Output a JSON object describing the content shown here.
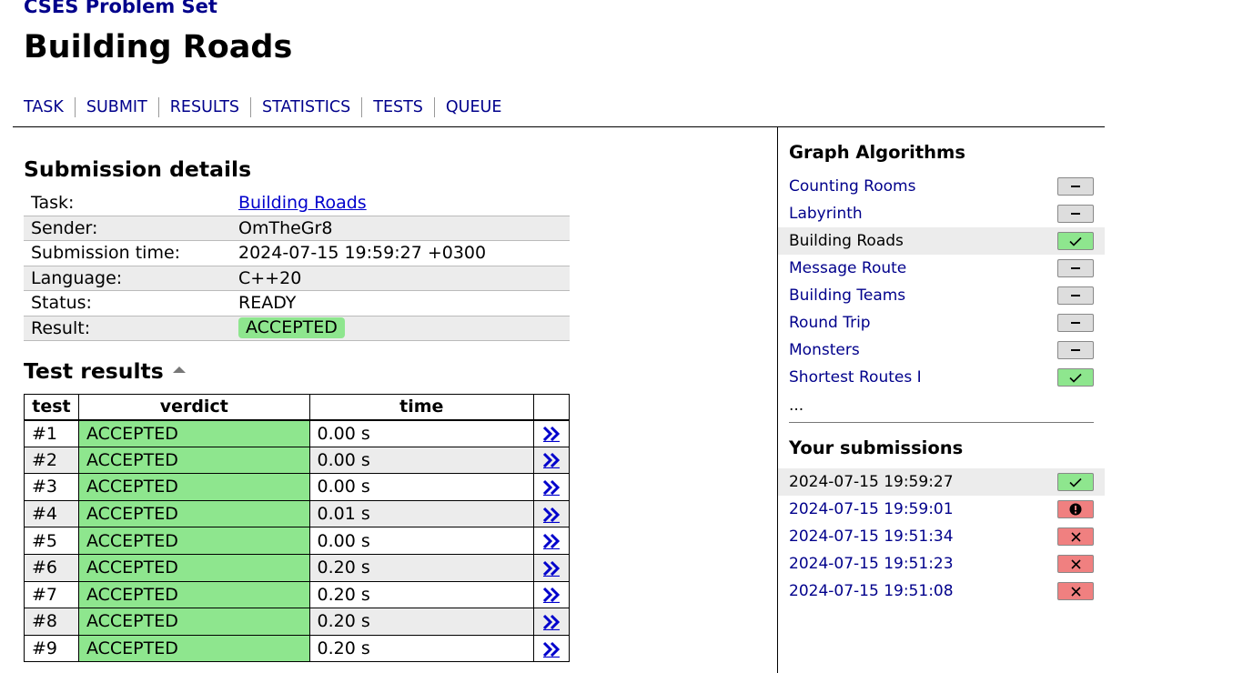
{
  "header": {
    "site_title": "CSES Problem Set",
    "page_title": "Building Roads"
  },
  "tabs": [
    "TASK",
    "SUBMIT",
    "RESULTS",
    "STATISTICS",
    "TESTS",
    "QUEUE"
  ],
  "details": {
    "heading": "Submission details",
    "rows": [
      {
        "label": "Task:",
        "value": "Building Roads"
      },
      {
        "label": "Sender:",
        "value": "OmTheGr8"
      },
      {
        "label": "Submission time:",
        "value": "2024-07-15 19:59:27 +0300"
      },
      {
        "label": "Language:",
        "value": "C++20"
      },
      {
        "label": "Status:",
        "value": "READY"
      },
      {
        "label": "Result:",
        "value": "ACCEPTED"
      }
    ]
  },
  "tests": {
    "heading": "Test results",
    "columns": [
      "test",
      "verdict",
      "time"
    ],
    "rows": [
      {
        "test": "#1",
        "verdict": "ACCEPTED",
        "time": "0.00 s"
      },
      {
        "test": "#2",
        "verdict": "ACCEPTED",
        "time": "0.00 s"
      },
      {
        "test": "#3",
        "verdict": "ACCEPTED",
        "time": "0.00 s"
      },
      {
        "test": "#4",
        "verdict": "ACCEPTED",
        "time": "0.01 s"
      },
      {
        "test": "#5",
        "verdict": "ACCEPTED",
        "time": "0.00 s"
      },
      {
        "test": "#6",
        "verdict": "ACCEPTED",
        "time": "0.20 s"
      },
      {
        "test": "#7",
        "verdict": "ACCEPTED",
        "time": "0.20 s"
      },
      {
        "test": "#8",
        "verdict": "ACCEPTED",
        "time": "0.20 s"
      },
      {
        "test": "#9",
        "verdict": "ACCEPTED",
        "time": "0.20 s"
      }
    ]
  },
  "sidebar": {
    "category": "Graph Algorithms",
    "problems": [
      {
        "name": "Counting Rooms",
        "status": "dash",
        "current": false
      },
      {
        "name": "Labyrinth",
        "status": "dash",
        "current": false
      },
      {
        "name": "Building Roads",
        "status": "ok",
        "current": true
      },
      {
        "name": "Message Route",
        "status": "dash",
        "current": false
      },
      {
        "name": "Building Teams",
        "status": "dash",
        "current": false
      },
      {
        "name": "Round Trip",
        "status": "dash",
        "current": false
      },
      {
        "name": "Monsters",
        "status": "dash",
        "current": false
      },
      {
        "name": "Shortest Routes I",
        "status": "ok",
        "current": false
      }
    ],
    "more": "...",
    "submissions_heading": "Your submissions",
    "submissions": [
      {
        "time": "2024-07-15 19:59:27",
        "status": "ok",
        "current": true
      },
      {
        "time": "2024-07-15 19:59:01",
        "status": "error",
        "current": false
      },
      {
        "time": "2024-07-15 19:51:34",
        "status": "wrong",
        "current": false
      },
      {
        "time": "2024-07-15 19:51:23",
        "status": "wrong",
        "current": false
      },
      {
        "time": "2024-07-15 19:51:08",
        "status": "wrong",
        "current": false
      }
    ]
  },
  "colors": {
    "accepted": "#8ee68e",
    "rejected": "#f08080",
    "link": "#00008b"
  }
}
